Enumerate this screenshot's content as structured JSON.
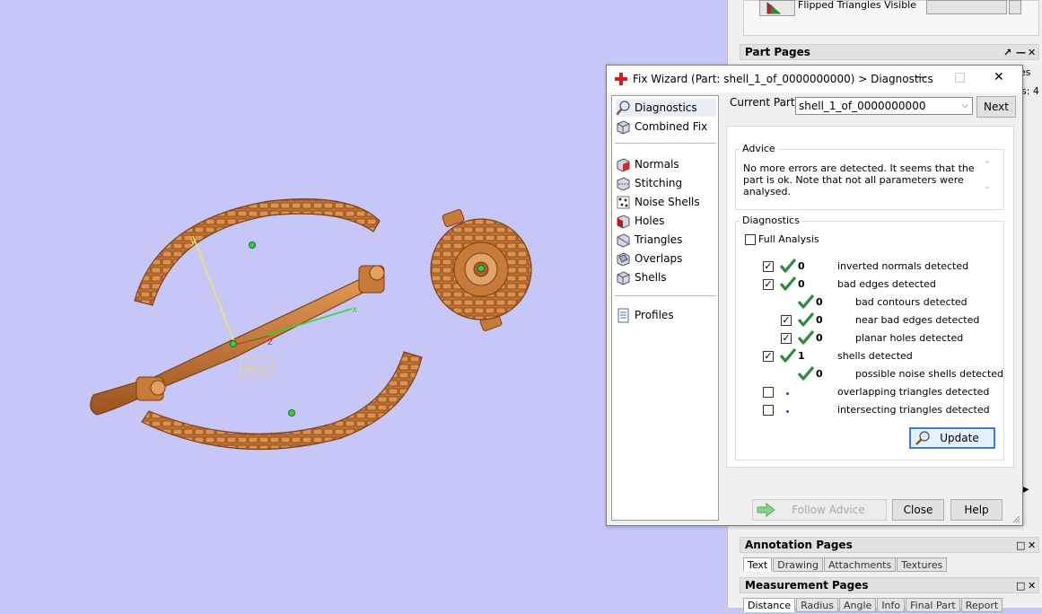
{
  "top_panel": {
    "flipped_label": "Flipped Triangles Visible"
  },
  "part_pages": {
    "title": "Part Pages",
    "partial_tab": "es",
    "partial_value": "s: 4"
  },
  "viewport": {
    "wcs_label": "WCS",
    "axis_x": "x",
    "axis_y": "y",
    "axis_z": "z"
  },
  "dialog": {
    "title": "Fix Wizard (Part: shell_1_of_0000000000) > Diagnostics",
    "nav": {
      "top": [
        "Diagnostics",
        "Combined Fix"
      ],
      "middle": [
        "Normals",
        "Stitching",
        "Noise Shells",
        "Holes",
        "Triangles",
        "Overlaps",
        "Shells"
      ],
      "bottom": [
        "Profiles"
      ]
    },
    "current_part_label": "Current Part:",
    "current_part_value": "shell_1_of_0000000000",
    "next_label": "Next",
    "advice_title": "Advice",
    "advice_text": "No more errors are detected. It seems that the part is ok. Note that not all parameters were analysed.",
    "diagnostics_title": "Diagnostics",
    "full_analysis_label": "Full Analysis",
    "rows": [
      {
        "checkbox": true,
        "checked": true,
        "status": "ok",
        "count": "0",
        "label": "inverted normals detected",
        "indent": 0
      },
      {
        "checkbox": true,
        "checked": true,
        "status": "ok",
        "count": "0",
        "label": "bad edges detected",
        "indent": 0
      },
      {
        "checkbox": false,
        "checked": false,
        "status": "ok",
        "count": "0",
        "label": "bad contours detected",
        "indent": 2
      },
      {
        "checkbox": true,
        "checked": true,
        "status": "ok",
        "count": "0",
        "label": "near bad edges detected",
        "indent": 2
      },
      {
        "checkbox": true,
        "checked": true,
        "status": "ok",
        "count": "0",
        "label": "planar holes detected",
        "indent": 2
      },
      {
        "checkbox": true,
        "checked": true,
        "status": "ok",
        "count": "1",
        "label": "shells detected",
        "indent": 0
      },
      {
        "checkbox": false,
        "checked": false,
        "status": "ok",
        "count": "0",
        "label": "possible noise shells detected",
        "indent": 2
      },
      {
        "checkbox": true,
        "checked": false,
        "status": "pending",
        "count": "",
        "label": "overlapping triangles detected",
        "indent": 0
      },
      {
        "checkbox": true,
        "checked": false,
        "status": "pending",
        "count": "",
        "label": "intersecting triangles detected",
        "indent": 0
      }
    ],
    "update_label": "Update",
    "follow_advice_label": "Follow Advice",
    "close_label": "Close",
    "help_label": "Help"
  },
  "annotation_pages": {
    "title": "Annotation Pages",
    "tabs": [
      "Text",
      "Drawing",
      "Attachments",
      "Textures"
    ]
  },
  "measurement_pages": {
    "title": "Measurement Pages",
    "tabs": [
      "Distance",
      "Radius",
      "Angle",
      "Info",
      "Final Part",
      "Report"
    ]
  },
  "colors": {
    "viewport_bg": "#c6c6f7",
    "part": "#c87a38",
    "tick": "#2e8b3a",
    "focus": "#3a7ed9"
  },
  "icons": {
    "dialog": "red-cross-icon",
    "diagnostics": "magnifier-icon",
    "combined_fix": "cube-icon",
    "profiles": "document-icon",
    "ok": "checkmark-icon",
    "pending": "dot-icon",
    "follow_advice": "green-arrow-icon"
  }
}
